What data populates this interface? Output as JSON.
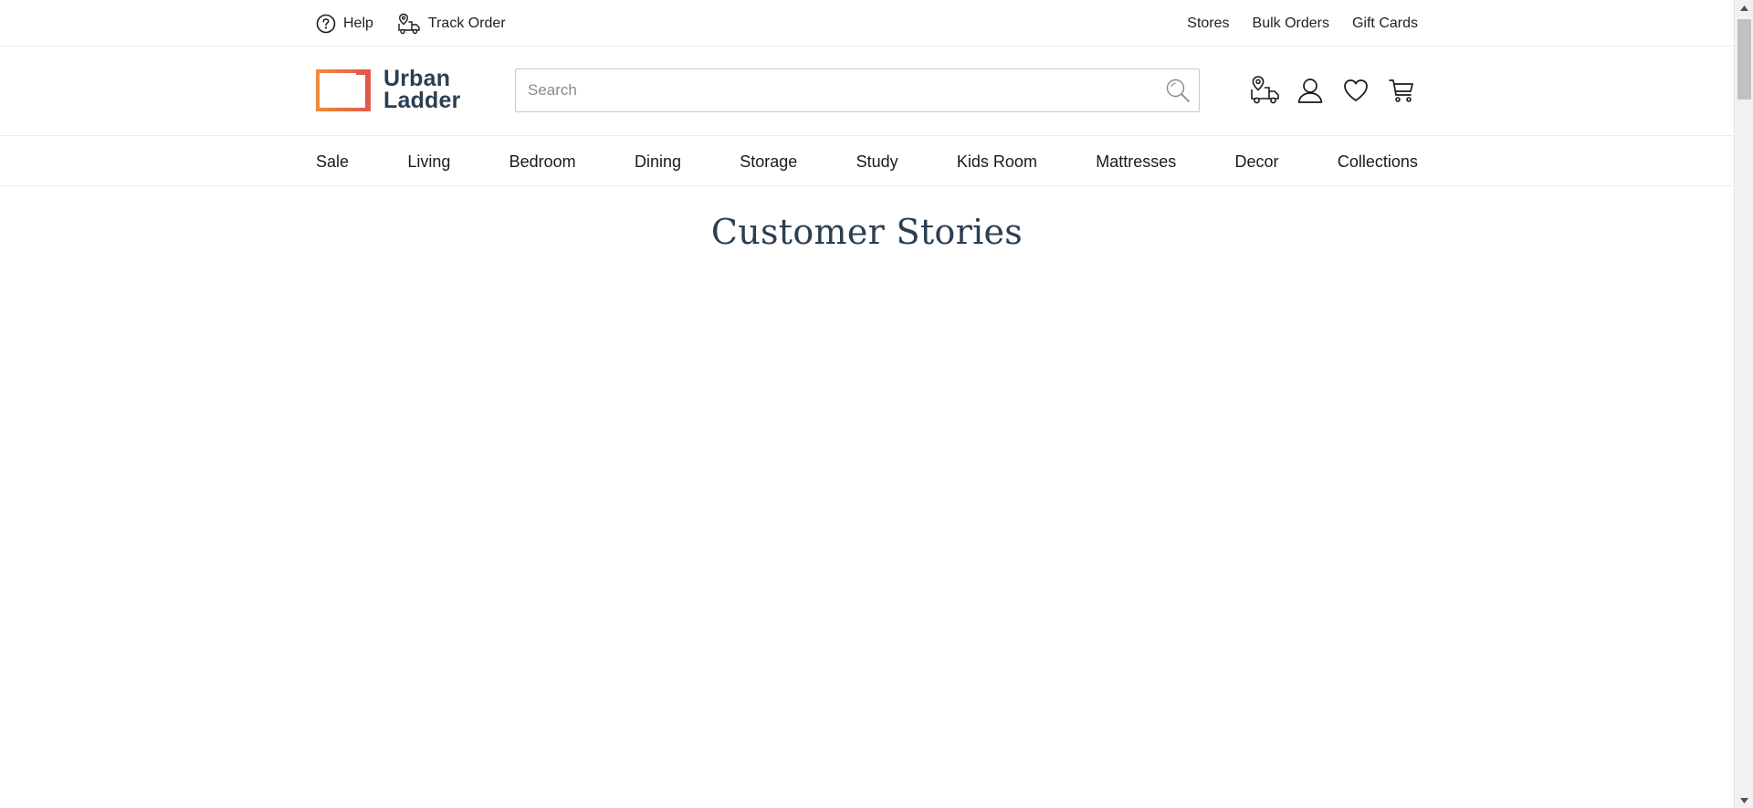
{
  "util_bar": {
    "help_label": "Help",
    "help_icon": "question-circle-icon",
    "track_order_label": "Track Order",
    "track_order_icon": "delivery-truck-pin-icon",
    "stores_label": "Stores",
    "bulk_orders_label": "Bulk Orders",
    "gift_cards_label": "Gift Cards"
  },
  "header": {
    "logo_line1": "Urban",
    "logo_line2": "Ladder",
    "search_placeholder": "Search",
    "search_value": "",
    "icons": [
      "delivery-truck-pin-icon",
      "user-icon",
      "heart-icon",
      "cart-icon"
    ]
  },
  "nav": {
    "items": [
      "Sale",
      "Living",
      "Bedroom",
      "Dining",
      "Storage",
      "Study",
      "Kids Room",
      "Mattresses",
      "Decor",
      "Collections"
    ]
  },
  "main": {
    "title": "Customer Stories"
  },
  "colors": {
    "brand_dark": "#2b3f52",
    "logo_orange": "#f08a3c",
    "logo_red": "#e25a4a",
    "divider": "#ececec"
  }
}
